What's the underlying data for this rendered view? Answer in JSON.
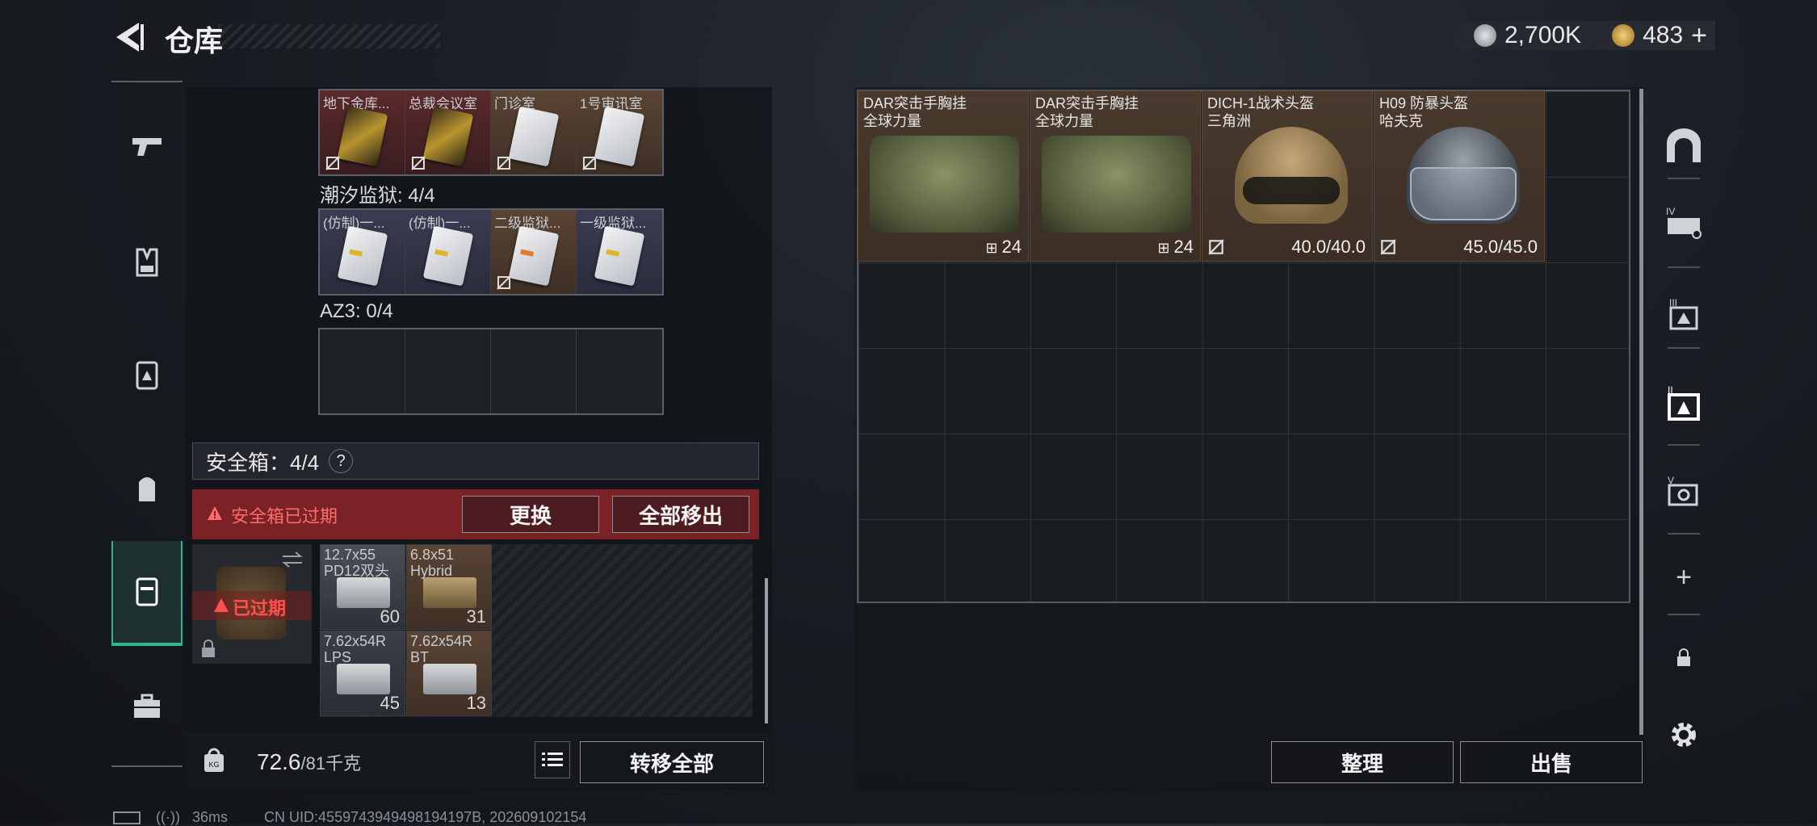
{
  "header": {
    "title": "仓库",
    "silver": "2,700K",
    "gold": "483",
    "gold_plus": "+"
  },
  "left_panel": {
    "keycards_top": [
      "地下金库...",
      "总裁会议室",
      "门诊室",
      "1号审讯室"
    ],
    "tide_prison_label": "潮汐监狱: 4/4",
    "tide_prison_cards": [
      "(仿制)一...",
      "(仿制)一...",
      "二级监狱...",
      "一级监狱..."
    ],
    "az3_label": "AZ3: 0/4",
    "safe_label": "安全箱：4/4",
    "help": "?",
    "expired_warning": "安全箱已过期",
    "replace_button": "更换",
    "remove_all_button": "全部移出",
    "expired_badge": "已过期",
    "ammo": [
      {
        "name": "12.7x55\nPD12双头",
        "count": "60"
      },
      {
        "name": "6.8x51\nHybrid",
        "count": "31"
      },
      {
        "name": "7.62x54R\nLPS",
        "count": "45"
      },
      {
        "name": "7.62x54R\nBT",
        "count": "13"
      }
    ],
    "weight": "72.6",
    "weight_max": "/81千克",
    "transfer_all_button": "转移全部"
  },
  "inventory": [
    {
      "name": "DAR突击手胸挂",
      "sub": "全球力量",
      "value": "24"
    },
    {
      "name": "DAR突击手胸挂",
      "sub": "全球力量",
      "value": "24"
    },
    {
      "name": "DICH-1战术头盔",
      "sub": "三角洲",
      "value": "40.0/40.0"
    },
    {
      "name": "H09 防暴头盔",
      "sub": "哈夫克",
      "value": "45.0/45.0"
    }
  ],
  "right_buttons": {
    "sort": "整理",
    "sell": "出售"
  },
  "status_bar": {
    "ping": "36ms",
    "uid": "CN UID:4559743949498194197B, 202609102154"
  },
  "colors": {
    "accent": "#2fb58a",
    "warning": "#ff6b6b",
    "expired_bg": "#7a2226"
  }
}
